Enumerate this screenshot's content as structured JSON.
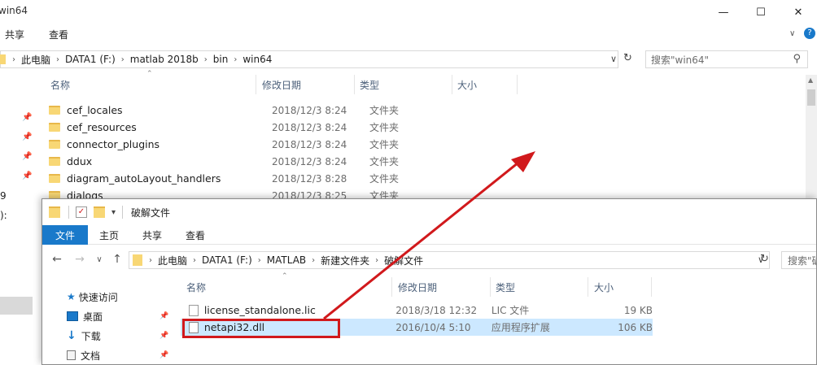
{
  "back": {
    "title": "win64",
    "ribbon_tabs": [
      "共享",
      "查看"
    ],
    "window_controls": [
      "minimize-icon",
      "maximize-icon",
      "close-icon"
    ],
    "breadcrumb": [
      "此电脑",
      "DATA1 (F:)",
      "matlab 2018b",
      "bin",
      "win64"
    ],
    "search_placeholder": "搜索\"win64\"",
    "columns": [
      "名称",
      "修改日期",
      "类型",
      "大小"
    ],
    "rows": [
      {
        "name": "cef_locales",
        "date": "2018/12/3 8:24",
        "type": "文件夹"
      },
      {
        "name": "cef_resources",
        "date": "2018/12/3 8:24",
        "type": "文件夹"
      },
      {
        "name": "connector_plugins",
        "date": "2018/12/3 8:24",
        "type": "文件夹"
      },
      {
        "name": "ddux",
        "date": "2018/12/3 8:24",
        "type": "文件夹"
      },
      {
        "name": "diagram_autoLayout_handlers",
        "date": "2018/12/3 8:28",
        "type": "文件夹"
      },
      {
        "name": "dialogs",
        "date": "2018/12/3 8:25",
        "type": "文件夹"
      }
    ],
    "left_fragments": [
      "9",
      "):"
    ]
  },
  "front": {
    "title": "破解文件",
    "ribbon_tabs": [
      "文件",
      "主页",
      "共享",
      "查看"
    ],
    "breadcrumb": [
      "此电脑",
      "DATA1 (F:)",
      "MATLAB",
      "新建文件夹",
      "破解文件"
    ],
    "search_placeholder": "搜索\"破",
    "nav_items": [
      {
        "label": "快速访问",
        "icon": "star-icon"
      },
      {
        "label": "桌面",
        "icon": "desktop-icon"
      },
      {
        "label": "下载",
        "icon": "download-icon"
      },
      {
        "label": "文档",
        "icon": "document-icon"
      }
    ],
    "columns": [
      "名称",
      "修改日期",
      "类型",
      "大小"
    ],
    "files": [
      {
        "name": "license_standalone.lic",
        "date": "2018/3/18 12:32",
        "type": "LIC 文件",
        "size": "19 KB"
      },
      {
        "name": "netapi32.dll",
        "date": "2016/10/4 5:10",
        "type": "应用程序扩展",
        "size": "106 KB"
      }
    ]
  },
  "colors": {
    "accent": "#1979ca",
    "selection": "#cce8ff",
    "highlight": "#d1191c",
    "folder": "#f8d775"
  }
}
